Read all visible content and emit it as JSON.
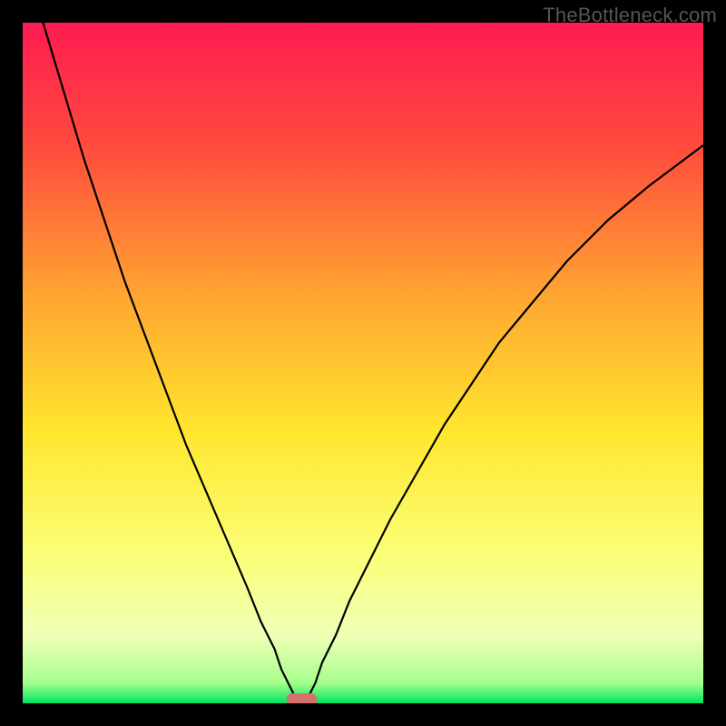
{
  "watermark": "TheBottleneck.com",
  "chart_data": {
    "type": "line",
    "title": "",
    "xlabel": "",
    "ylabel": "",
    "xlim": [
      0,
      100
    ],
    "ylim": [
      0,
      100
    ],
    "grid": false,
    "gradient_stops": [
      {
        "offset": 0,
        "color": "#ff1b52"
      },
      {
        "offset": 0.18,
        "color": "#ff4a3d"
      },
      {
        "offset": 0.4,
        "color": "#ffa531"
      },
      {
        "offset": 0.6,
        "color": "#ffe62e"
      },
      {
        "offset": 0.78,
        "color": "#fbff77"
      },
      {
        "offset": 0.9,
        "color": "#f0ffb6"
      },
      {
        "offset": 0.97,
        "color": "#a6ff8c"
      },
      {
        "offset": 1.0,
        "color": "#00e463"
      }
    ],
    "minimum_marker": {
      "x": 41,
      "y": 0,
      "color": "#d6716b"
    },
    "series": [
      {
        "name": "bottleneck-curve",
        "color": "#000000",
        "x": [
          0,
          3,
          6,
          9,
          12,
          15,
          18,
          21,
          24,
          27,
          30,
          33,
          35,
          37,
          38,
          39,
          40,
          41,
          42,
          43,
          44,
          46,
          48,
          51,
          54,
          58,
          62,
          66,
          70,
          75,
          80,
          86,
          92,
          100
        ],
        "y": [
          110,
          100,
          90,
          80,
          71,
          62,
          54,
          46,
          38,
          31,
          24,
          17,
          12,
          8,
          5,
          3,
          1,
          0,
          1,
          3,
          6,
          10,
          15,
          21,
          27,
          34,
          41,
          47,
          53,
          59,
          65,
          71,
          76,
          82
        ]
      }
    ]
  }
}
